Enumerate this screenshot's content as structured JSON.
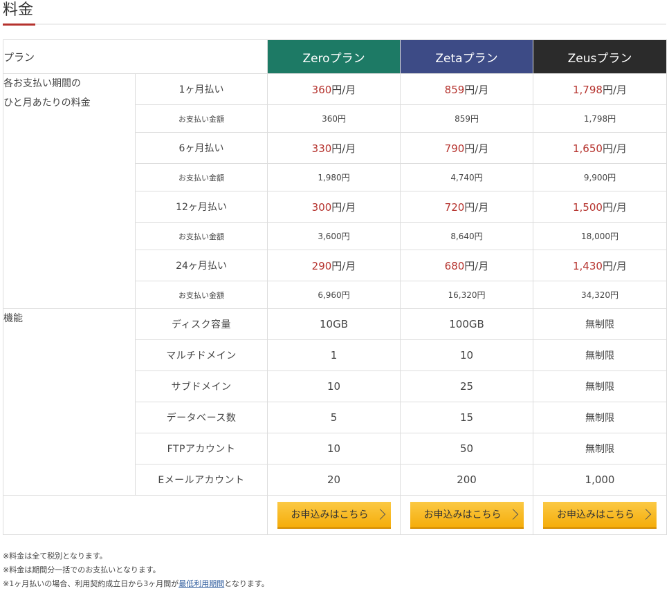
{
  "section_title": "料金",
  "plans": {
    "label": "プラン",
    "names": [
      "Zeroプラン",
      "Zetaプラン",
      "Zeusプラン"
    ],
    "colors": [
      "#1d7a65",
      "#3d4b86",
      "#2b2b2b"
    ]
  },
  "pricing": {
    "group_label_line1": "各お支払い期間の",
    "group_label_line2": "ひと月あたりの料金",
    "total_label": "お支払い金額",
    "monthly_unit": "円/月",
    "periods": [
      {
        "label": "1ヶ月払い",
        "monthly": [
          "360",
          "859",
          "1,798"
        ],
        "totals": [
          "360円",
          "859円",
          "1,798円"
        ]
      },
      {
        "label": "6ヶ月払い",
        "monthly": [
          "330",
          "790",
          "1,650"
        ],
        "totals": [
          "1,980円",
          "4,740円",
          "9,900円"
        ]
      },
      {
        "label": "12ヶ月払い",
        "monthly": [
          "300",
          "720",
          "1,500"
        ],
        "totals": [
          "3,600円",
          "8,640円",
          "18,000円"
        ]
      },
      {
        "label": "24ヶ月払い",
        "monthly": [
          "290",
          "680",
          "1,430"
        ],
        "totals": [
          "6,960円",
          "16,320円",
          "34,320円"
        ]
      }
    ]
  },
  "features": {
    "group_label": "機能",
    "rows": [
      {
        "label": "ディスク容量",
        "values": [
          "10GB",
          "100GB",
          "無制限"
        ]
      },
      {
        "label": "マルチドメイン",
        "values": [
          "1",
          "10",
          "無制限"
        ]
      },
      {
        "label": "サブドメイン",
        "values": [
          "10",
          "25",
          "無制限"
        ]
      },
      {
        "label": "データベース数",
        "values": [
          "5",
          "15",
          "無制限"
        ]
      },
      {
        "label": "FTPアカウント",
        "values": [
          "10",
          "50",
          "無制限"
        ]
      },
      {
        "label": "Eメールアカウント",
        "values": [
          "20",
          "200",
          "1,000"
        ]
      }
    ]
  },
  "cta_label": "お申込みはこちら",
  "notes": {
    "line1": "※料金は全て税別となります。",
    "line2": "※料金は期間分一括でのお支払いとなります。",
    "line3_prefix": "※1ヶ月払いの場合、利用契約成立日から3ヶ月間が",
    "line3_link": "最低利用期間",
    "line3_suffix": "となります。"
  },
  "accent_color": "#b5322d"
}
